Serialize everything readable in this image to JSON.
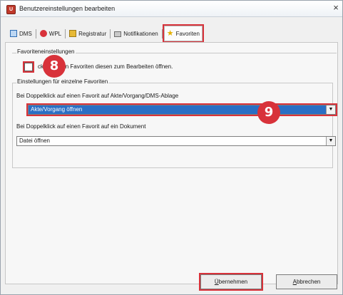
{
  "window": {
    "title": "Benutzereinstellungen bearbeiten",
    "app_icon_glyph": "U",
    "close_glyph": "×"
  },
  "tabs": [
    {
      "label": "DMS",
      "icon": "dms-icon"
    },
    {
      "label": "WPL",
      "icon": "wpl-icon"
    },
    {
      "label": "Registratur",
      "icon": "registratur-icon"
    },
    {
      "label": "Notifikationen",
      "icon": "notification-icon"
    },
    {
      "label": "Favoriten",
      "icon": "star-icon",
      "active": true
    }
  ],
  "favorites_settings": {
    "group_label": "Favoriteneinstellungen",
    "checkbox_checked": false,
    "checkbox_label": "ck auf einen Favoriten diesen zum Bearbeiten öffnen."
  },
  "single_favorites": {
    "group_label": "Einstellungen für einzelne Favoriten",
    "file_label": "Bei Doppelklick auf einen Favorit auf Akte/Vorgang/DMS-Ablage",
    "file_value": "Akte/Vorgang öffnen",
    "doc_label": "Bei Doppelklick auf einen Favorit auf ein Dokument",
    "doc_value": "Datei öffnen",
    "dropdown_glyph": "▼"
  },
  "badges": {
    "checkbox_badge": "8",
    "dropdown_badge": "9"
  },
  "buttons": {
    "apply_mnemonic": "Ü",
    "apply_rest": "bernehmen",
    "cancel_mnemonic": "A",
    "cancel_rest": "bbrechen"
  },
  "colors": {
    "highlight_red": "#d8323a",
    "selection_blue": "#2a6fc4"
  }
}
